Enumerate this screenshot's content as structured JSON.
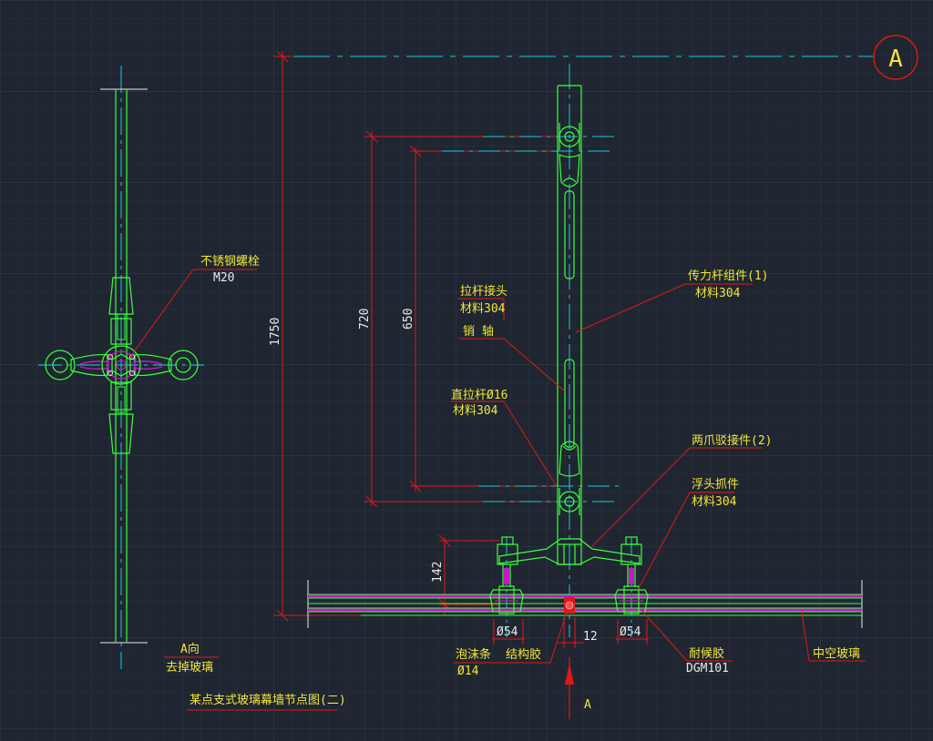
{
  "colors": {
    "background": "#1f2631",
    "grid": "#2b3442",
    "grid_major": "#34404f",
    "outline": "#3dff3d",
    "centerline": "#18c8d8",
    "dimension": "#e01818",
    "leader": "#e01818",
    "label": "#f2e63a",
    "glass_magenta": "#c418c8",
    "white": "#e9e9e9"
  },
  "grid_label": "A",
  "section_marker": "A",
  "view_label": "A向",
  "view_sublabel": "去掉玻璃",
  "drawing_title": "某点支式玻璃幕墙节点图(二)",
  "dimensions": {
    "overall": "1750",
    "outer": "720",
    "inner": "650",
    "base": "142",
    "gap": "12",
    "hole_left": "Ø54",
    "hole_right": "Ø54"
  },
  "callouts": {
    "bolt": {
      "line1": "不锈钢螺栓",
      "line2": "M20"
    },
    "rod_connector": {
      "line1": "拉杆接头",
      "line2": "材料304"
    },
    "pin": {
      "line1": "销  轴"
    },
    "vertical_rod": {
      "line1": "直拉杆Ø16",
      "line2": "材料304"
    },
    "truss_member": {
      "line1": "传力杆组件(1)",
      "line2": "材料304"
    },
    "spider_fitting": {
      "line1": "两爪驳接件(2)"
    },
    "floating_head": {
      "line1": "浮头抓件",
      "line2": "材料304"
    },
    "foam_strip": {
      "line1": "泡沫条",
      "line2": "Ø14"
    },
    "structural_sealant": {
      "line1": "结构胶"
    },
    "weather_sealant": {
      "line1": "耐候胶",
      "line2": "DGM101"
    },
    "insulated_glass": {
      "line1": "中空玻璃"
    }
  }
}
